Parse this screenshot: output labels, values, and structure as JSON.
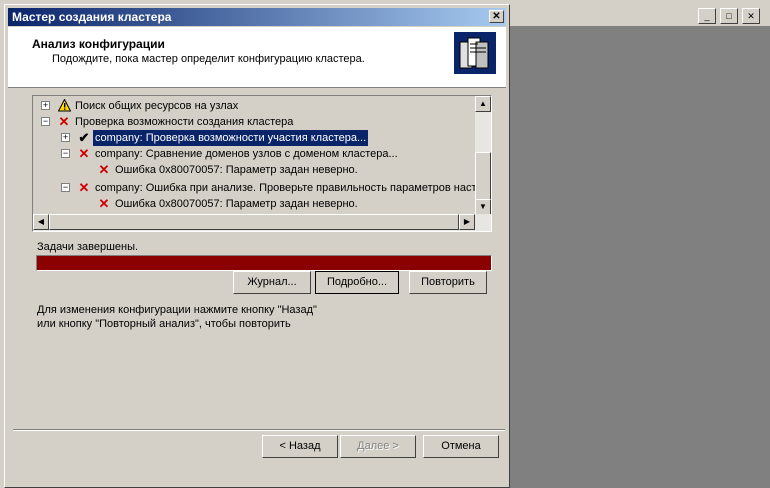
{
  "dialog": {
    "title": "Мастер создания кластера",
    "close_glyph": "✕",
    "header_title": "Анализ конфигурации",
    "header_subtitle": "Подождите, пока мастер определит конфигурацию кластера."
  },
  "tree": {
    "items": [
      {
        "expander": "+",
        "icon": "warning",
        "label": "Поиск общих ресурсов на узлах"
      },
      {
        "expander": "−",
        "icon": "error",
        "label": "Проверка возможности создания кластера"
      },
      {
        "expander": "+",
        "icon": "check",
        "label": "company: Проверка возможности участия кластера..."
      },
      {
        "expander": "−",
        "icon": "error",
        "label": "company: Сравнение доменов узлов с доменом кластера..."
      },
      {
        "expander": "",
        "icon": "error",
        "label": "Ошибка 0x80070057: Параметр задан неверно."
      },
      {
        "expander": "−",
        "icon": "error",
        "label": "company: Ошибка при анализе. Проверьте правильность параметров наст"
      },
      {
        "expander": "",
        "icon": "error",
        "label": "Ошибка 0x80070057: Параметр задан неверно."
      }
    ]
  },
  "status_text": "Задачи завершены.",
  "progress": 1.0,
  "progress_color": "#8b0000",
  "buttons": {
    "log": "Журнал...",
    "details": "Подробно...",
    "retry": "Повторить",
    "back": "< Назад",
    "next": "Далее >",
    "cancel": "Отмена"
  },
  "info_line1": "Для изменения конфигурации нажмите кнопку \"Назад\"",
  "info_line2": "или кнопку \"Повторный анализ\", чтобы повторить"
}
